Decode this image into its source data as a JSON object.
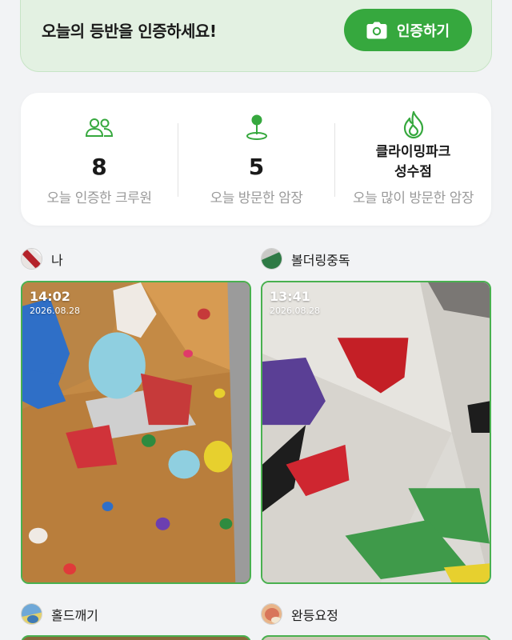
{
  "banner": {
    "title": "오늘의 등반을 인증하세요!",
    "button_label": "인증하기",
    "button_icon": "camera-icon"
  },
  "stats": [
    {
      "icon": "crew-users-icon",
      "value": "8",
      "label": "오늘 인증한 크루원"
    },
    {
      "icon": "location-pin-icon",
      "value": "5",
      "label": "오늘 방문한 암장"
    },
    {
      "icon": "flame-icon",
      "value_line1": "클라이밍파크",
      "value_line2": "성수점",
      "label": "오늘 많이 방문한 암장"
    }
  ],
  "feed": [
    {
      "user": "나",
      "time": "14:02",
      "date": "2026.08.28"
    },
    {
      "user": "볼더링중독",
      "time": "13:41",
      "date": "2026.08.28"
    },
    {
      "user": "홀드깨기"
    },
    {
      "user": "완등요정"
    }
  ],
  "colors": {
    "accent": "#36a83e",
    "banner_bg": "#e3f1e2",
    "card_border": "#49b04f",
    "label_gray": "#9a9a9a"
  }
}
